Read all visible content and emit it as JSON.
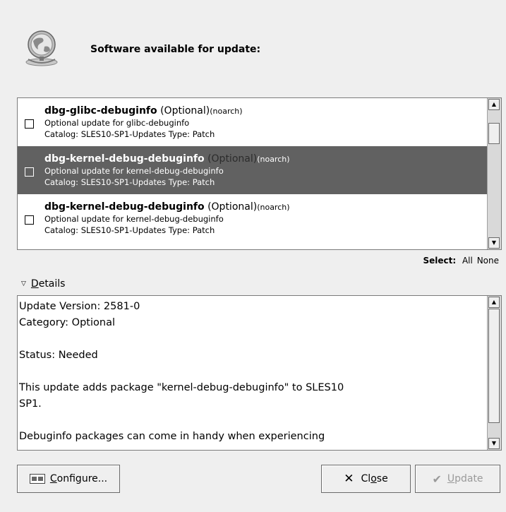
{
  "header": {
    "title": "Software available for update:",
    "icon": "globe-network-icon"
  },
  "packages": [
    {
      "name": "dbg-glibc-debuginfo",
      "optional": "(Optional)",
      "arch": "(noarch)",
      "description": "Optional update for glibc-debuginfo",
      "catalog": "Catalog: SLES10-SP1-Updates Type: Patch",
      "checked": false,
      "selected": false
    },
    {
      "name": "dbg-kernel-debug-debuginfo",
      "optional": "(Optional)",
      "arch": "(noarch)",
      "description": "Optional update for kernel-debug-debuginfo",
      "catalog": "Catalog: SLES10-SP1-Updates Type: Patch",
      "checked": false,
      "selected": true
    },
    {
      "name": "dbg-kernel-debug-debuginfo",
      "optional": "(Optional)",
      "arch": "(noarch)",
      "description": "Optional update for kernel-debug-debuginfo",
      "catalog": "Catalog: SLES10-SP1-Updates Type: Patch",
      "checked": false,
      "selected": false
    }
  ],
  "select": {
    "label": "Select:",
    "all": "All",
    "none": "None"
  },
  "details": {
    "label": "Details",
    "text": "Update Version: 2581-0\nCategory: Optional\n\nStatus: Needed\n\nThis update adds package \"kernel-debug-debuginfo\" to SLES10\nSP1.\n\nDebuginfo packages can come in handy when experiencing"
  },
  "buttons": {
    "configure": "Configure...",
    "close": "Close",
    "update": "Update"
  }
}
